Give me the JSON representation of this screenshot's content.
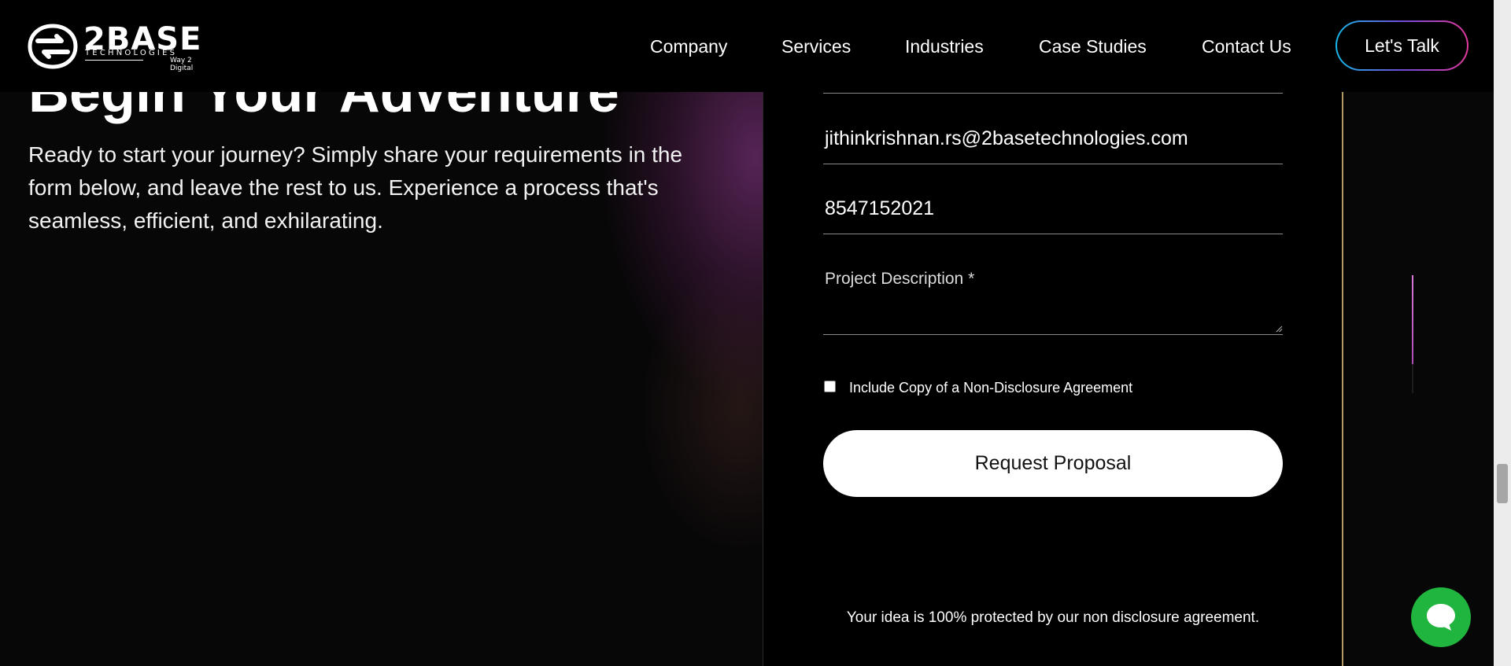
{
  "header": {
    "logo": {
      "word": "2BASE",
      "sub": "TECHNOLOGIES",
      "tagline": "Way 2 Digital"
    },
    "nav": [
      {
        "label": "Company"
      },
      {
        "label": "Services"
      },
      {
        "label": "Industries"
      },
      {
        "label": "Case Studies"
      },
      {
        "label": "Contact Us"
      }
    ],
    "cta_label": "Let's Talk"
  },
  "hero": {
    "title": "Begin Your Adventure",
    "description": "Ready to start your journey? Simply share your requirements in the form below, and leave the rest to us. Experience a process that's seamless, efficient, and exhilarating."
  },
  "form": {
    "email_value": "jithinkrishnan.rs@2basetechnologies.com",
    "phone_value": "8547152021",
    "description_label": "Project Description *",
    "nda_checkbox_label": "Include Copy of a Non-Disclosure Agreement",
    "nda_checked": false,
    "submit_label": "Request Proposal",
    "nda_note": "Your idea is 100% protected by our non disclosure agreement."
  },
  "icons": {
    "logo": "2base-logo-mark",
    "chat": "chat-bubble-icon"
  },
  "colors": {
    "background": "#000000",
    "accent_gradient_start": "#16b7e8",
    "accent_gradient_end": "#e23a9e",
    "panel_border": "#b49a66",
    "chat_button": "#20b53e",
    "submit_bg": "#ffffff"
  },
  "section_progress": 0.75
}
